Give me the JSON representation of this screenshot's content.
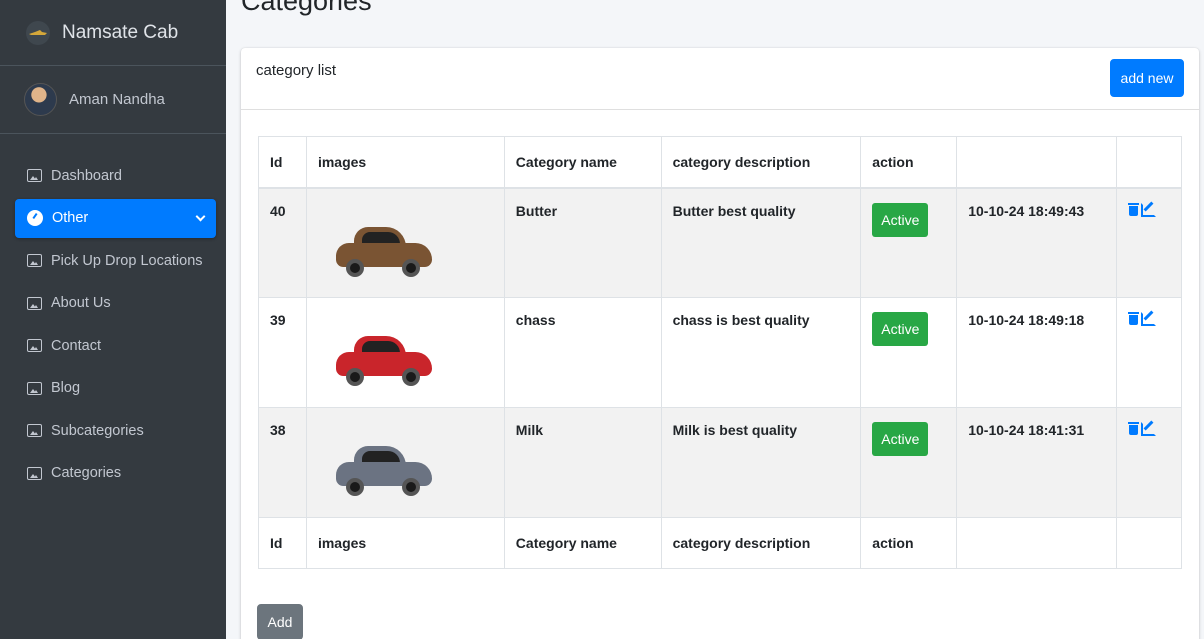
{
  "brand": {
    "name": "Namsate Cab"
  },
  "user": {
    "name": "Aman Nandha"
  },
  "sidebar": {
    "items": [
      {
        "label": "Dashboard"
      },
      {
        "label": "Other"
      },
      {
        "label": "Pick Up Drop Locations"
      },
      {
        "label": "About Us"
      },
      {
        "label": "Contact"
      },
      {
        "label": "Blog"
      },
      {
        "label": "Subcategories"
      },
      {
        "label": "Categories"
      }
    ]
  },
  "page": {
    "title": "Categories"
  },
  "card": {
    "title": "category list",
    "add_new_label": "add new",
    "add_label": "Add"
  },
  "table": {
    "headers": [
      "Id",
      "images",
      "Category name",
      "category description",
      "action",
      ""
    ],
    "rows": [
      {
        "id": "40",
        "name": "Butter",
        "description": "Butter best quality",
        "status": "Active",
        "date": "10-10-24 18:49:43",
        "car_color": "#7a5433"
      },
      {
        "id": "39",
        "name": "chass",
        "description": "chass is best quality",
        "status": "Active",
        "date": "10-10-24 18:49:18",
        "car_color": "#c9252b"
      },
      {
        "id": "38",
        "name": "Milk",
        "description": "Milk is best quality",
        "status": "Active",
        "date": "10-10-24 18:41:31",
        "car_color": "#6b7382"
      }
    ]
  },
  "colors": {
    "primary": "#007bff",
    "success": "#28a745",
    "sidebar": "#343a40",
    "secondary": "#6c757d"
  }
}
